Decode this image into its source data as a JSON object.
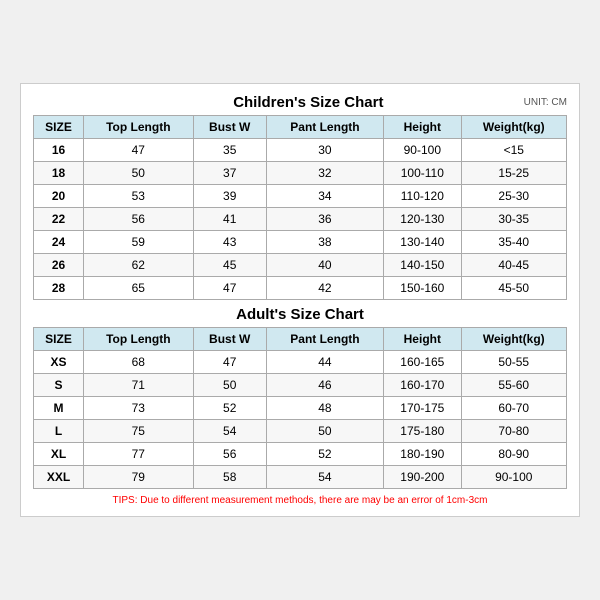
{
  "children_title": "Children's Size Chart",
  "adult_title": "Adult's Size Chart",
  "unit": "UNIT: CM",
  "headers": [
    "SIZE",
    "Top Length",
    "Bust W",
    "Pant Length",
    "Height",
    "Weight(kg)"
  ],
  "children_rows": [
    [
      "16",
      "47",
      "35",
      "30",
      "90-100",
      "<15"
    ],
    [
      "18",
      "50",
      "37",
      "32",
      "100-110",
      "15-25"
    ],
    [
      "20",
      "53",
      "39",
      "34",
      "110-120",
      "25-30"
    ],
    [
      "22",
      "56",
      "41",
      "36",
      "120-130",
      "30-35"
    ],
    [
      "24",
      "59",
      "43",
      "38",
      "130-140",
      "35-40"
    ],
    [
      "26",
      "62",
      "45",
      "40",
      "140-150",
      "40-45"
    ],
    [
      "28",
      "65",
      "47",
      "42",
      "150-160",
      "45-50"
    ]
  ],
  "adult_rows": [
    [
      "XS",
      "68",
      "47",
      "44",
      "160-165",
      "50-55"
    ],
    [
      "S",
      "71",
      "50",
      "46",
      "160-170",
      "55-60"
    ],
    [
      "M",
      "73",
      "52",
      "48",
      "170-175",
      "60-70"
    ],
    [
      "L",
      "75",
      "54",
      "50",
      "175-180",
      "70-80"
    ],
    [
      "XL",
      "77",
      "56",
      "52",
      "180-190",
      "80-90"
    ],
    [
      "XXL",
      "79",
      "58",
      "54",
      "190-200",
      "90-100"
    ]
  ],
  "tips": "TIPS: Due to different measurement methods, there are may be an error of 1cm-3cm"
}
